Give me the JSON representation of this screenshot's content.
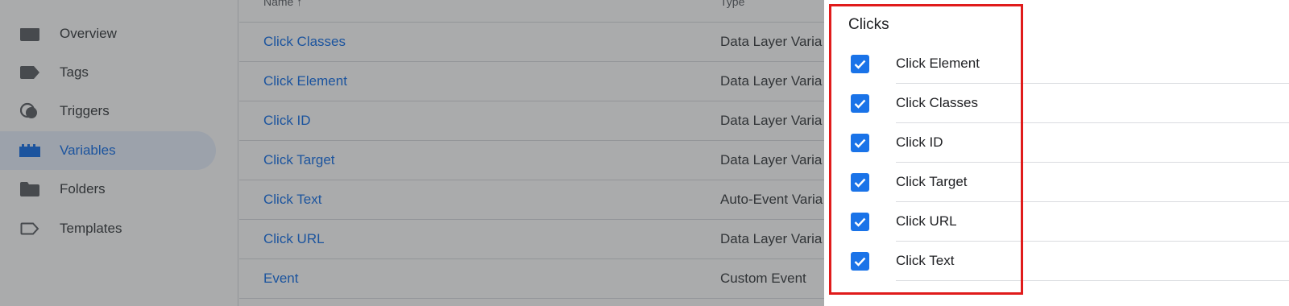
{
  "colors": {
    "accent": "#1a73e8",
    "highlight": "#e01b1b",
    "active_nav_bg": "#e8f0fe"
  },
  "sidebar": {
    "items": [
      {
        "label": "Overview",
        "icon": "overview-icon",
        "active": false
      },
      {
        "label": "Tags",
        "icon": "tag-icon",
        "active": false
      },
      {
        "label": "Triggers",
        "icon": "trigger-icon",
        "active": false
      },
      {
        "label": "Variables",
        "icon": "variables-icon",
        "active": true
      },
      {
        "label": "Folders",
        "icon": "folder-icon",
        "active": false
      },
      {
        "label": "Templates",
        "icon": "template-icon",
        "active": false
      }
    ]
  },
  "table": {
    "headers": {
      "name": "Name",
      "name_sort": "↑",
      "type": "Type"
    },
    "rows": [
      {
        "name": "Click Classes",
        "type": "Data Layer Varia"
      },
      {
        "name": "Click Element",
        "type": "Data Layer Varia"
      },
      {
        "name": "Click ID",
        "type": "Data Layer Varia"
      },
      {
        "name": "Click Target",
        "type": "Data Layer Varia"
      },
      {
        "name": "Click Text",
        "type": "Auto-Event Varia"
      },
      {
        "name": "Click URL",
        "type": "Data Layer Varia"
      },
      {
        "name": "Event",
        "type": "Custom Event"
      }
    ]
  },
  "panel": {
    "section_title": "Clicks",
    "options": [
      {
        "label": "Click Element",
        "checked": true
      },
      {
        "label": "Click Classes",
        "checked": true
      },
      {
        "label": "Click ID",
        "checked": true
      },
      {
        "label": "Click Target",
        "checked": true
      },
      {
        "label": "Click URL",
        "checked": true
      },
      {
        "label": "Click Text",
        "checked": true
      }
    ]
  }
}
